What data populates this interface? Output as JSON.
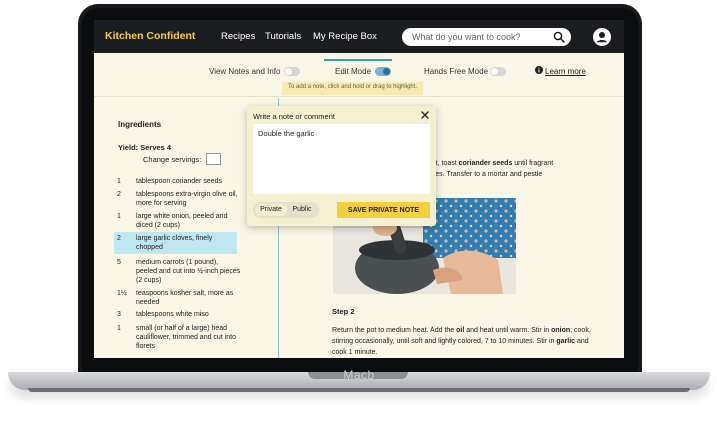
{
  "device": {
    "brand_label": "Macb"
  },
  "nav": {
    "logo": "Kitchen Confident",
    "links": [
      "Recipes",
      "Tutorials",
      "My Recipe Box"
    ],
    "search_placeholder": "What do you want to cook?"
  },
  "toolbar": {
    "view_notes_label": "View Notes and Info",
    "view_notes_on": false,
    "edit_mode_label": "Edit Mode",
    "edit_mode_on": true,
    "hands_free_label": "Hands Free Mode",
    "hands_free_on": false,
    "hint": "To add a note, click and hold or drag to highlight.",
    "learn_more": "Learn more"
  },
  "ingredients": {
    "title": "Ingredients",
    "yield": "Yield:  Serves 4",
    "change_servings": "Change servings:",
    "items": [
      {
        "qty": "1",
        "text": "tablespoon coriander seeds"
      },
      {
        "qty": "2",
        "text": "tablespoons extra-virgin olive oil, more for serving"
      },
      {
        "qty": "1",
        "text": "large white onion, peeled and diced (2 cups)"
      },
      {
        "qty": "2",
        "text": "large garlic cloves, finely chopped",
        "highlighted": true
      },
      {
        "qty": "5",
        "text": "medium carrots (1 pound), peeled and cut into ½-inch pieces (2 cups)"
      },
      {
        "qty": "1½",
        "text": "teaspoons kosher salt, more as needed"
      },
      {
        "qty": "3",
        "text": "tablespoons white miso"
      },
      {
        "qty": "1",
        "text": "small (or half of a large) head cauliflower, trimmed and cut into florets"
      }
    ]
  },
  "steps": {
    "step1_line1_a": "heat, toast ",
    "step1_line1_b": "coriander seeds",
    "step1_line1_c": " until fragrant",
    "step1_line2": "inutes. Transfer to a mortar and pestle",
    "step2_title": "Step 2",
    "step2_a": "Return the pot to medium heat. Add the ",
    "step2_b": "oil",
    "step2_c": " and heat until warm. Stir in ",
    "step2_d": "onion",
    "step2_e": "; cook, stirring occasionally, until soft and lightly colored, 7 to 10 minutes. Stir in ",
    "step2_f": "garlic",
    "step2_g": " and cook 1 minute."
  },
  "note": {
    "title": "Write a note or comment",
    "value": "Double the garlic",
    "private_label": "Private",
    "public_label": "Public",
    "save_label": "SAVE PRIVATE NOTE"
  },
  "colors": {
    "accent_yellow": "#f4d03f",
    "nav_bg": "#1c1d20",
    "page_bg": "#fbf7e6",
    "highlight": "#bfe7ef"
  }
}
